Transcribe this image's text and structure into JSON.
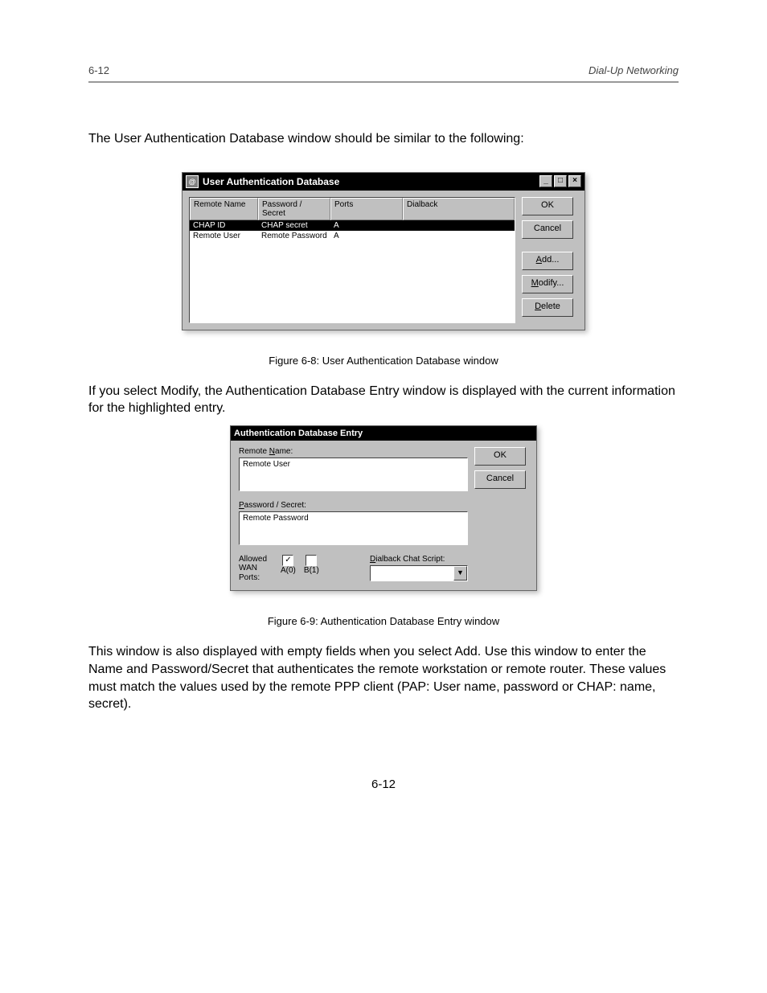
{
  "chapter": {
    "left": "6-12",
    "right": "Dial-Up Networking"
  },
  "intro": "The User Authentication Database window should be similar to the following:",
  "win1": {
    "title": "User Authentication Database",
    "icon_glyph": "@",
    "headers": {
      "remote_name": "Remote Name",
      "password": "Password / Secret",
      "ports": "Ports",
      "dialback": "Dialback"
    },
    "rows": [
      {
        "remote_name": "CHAP ID",
        "password": "CHAP secret",
        "ports": "A",
        "dialback": "",
        "selected": true
      },
      {
        "remote_name": "Remote User",
        "password": "Remote Password",
        "ports": "A",
        "dialback": "",
        "selected": false
      }
    ],
    "buttons": {
      "ok": "OK",
      "cancel": "Cancel",
      "add": "Add...",
      "modify": "Modify...",
      "delete": "Delete"
    }
  },
  "caption1": "Figure 6-8: User Authentication Database window",
  "mid_para": "If you select Modify, the Authentication Database Entry window is displayed with the current information for the highlighted entry.",
  "win2": {
    "title": "Authentication Database Entry",
    "remote_name_label": "Remote Name:",
    "remote_name_value": "Remote User",
    "password_label": "Password / Secret:",
    "password_value": "Remote Password",
    "allowed_label_line1": "Allowed",
    "allowed_label_line2": "WAN",
    "allowed_label_line3": "Ports:",
    "port_a": "A(0)",
    "port_b": "B(1)",
    "port_a_checked": "✓",
    "dialback_label": "Dialback Chat Script:",
    "dialback_value": "",
    "buttons": {
      "ok": "OK",
      "cancel": "Cancel"
    }
  },
  "caption2": "Figure 6-9: Authentication Database Entry window",
  "end_para": "This window is also displayed with empty fields when you select Add. Use this window to enter the Name and Password/Secret that authenticates the remote workstation or remote router. These values must match the values used by the remote PPP client (PAP: User name, password or CHAP: name, secret).",
  "page_number": "6-12"
}
